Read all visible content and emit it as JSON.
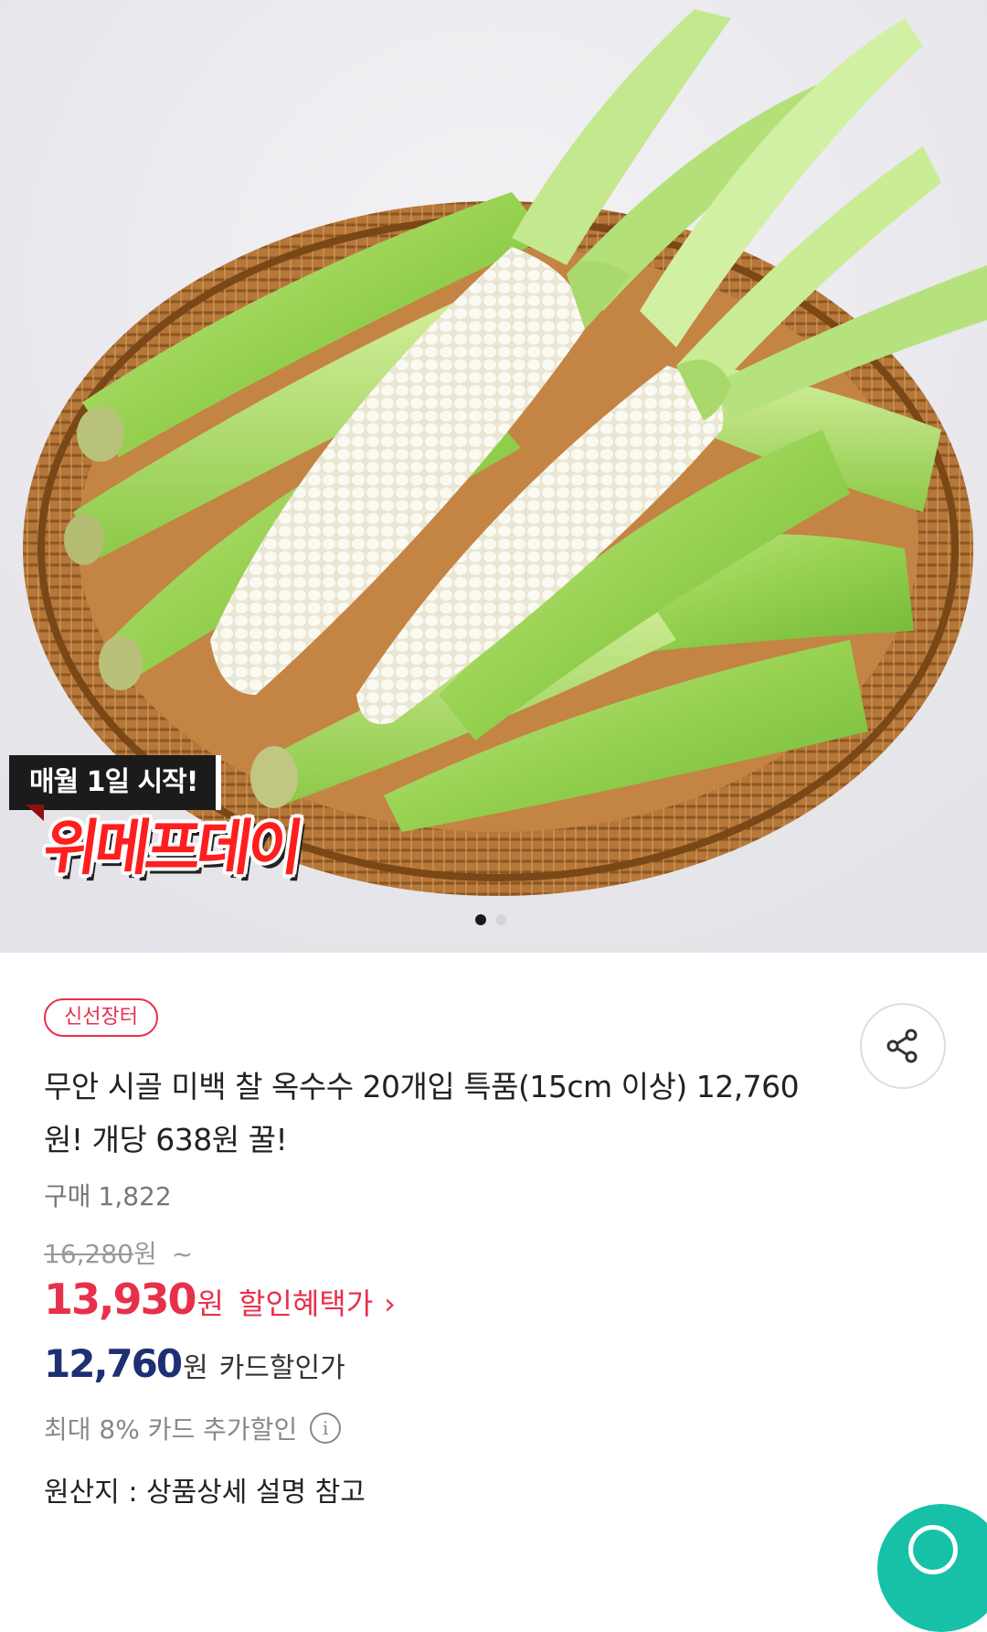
{
  "hero": {
    "promo_top": "매월 1일 시작!",
    "promo_main": "위메프데이",
    "carousel": {
      "current": 1,
      "total": 2
    }
  },
  "product": {
    "category_badge": "신선장터",
    "title": "무안 시골 미백 찰 옥수수 20개입 특품(15cm 이상) 12,760원! 개당 638원 꿀!",
    "purchase_label": "구매",
    "purchase_count": "1,822",
    "original_price": "16,280",
    "original_unit": "원",
    "original_suffix": "~",
    "sale_price": "13,930",
    "sale_unit": "원",
    "sale_label": "할인혜택가",
    "sale_chevron": "›",
    "card_price": "12,760",
    "card_unit": "원",
    "card_label": "카드할인가",
    "extra_discount": "최대 8% 카드 추가할인",
    "info_icon": "i",
    "origin": "원산지 : 상품상세 설명 참고"
  },
  "icons": {
    "share": "share-icon",
    "info": "info-icon"
  },
  "colors": {
    "accent_red": "#e8304a",
    "card_blue": "#1f2f74",
    "fab_teal": "#17c1a8"
  }
}
